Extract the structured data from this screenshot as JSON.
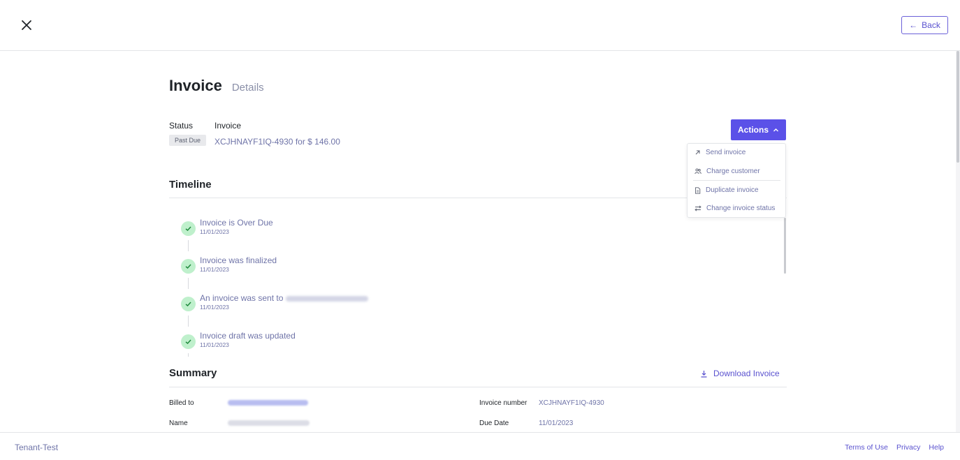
{
  "header": {
    "back_label": "Back",
    "back_arrow": "←"
  },
  "page": {
    "title": "Invoice",
    "subtitle": "Details"
  },
  "status": {
    "label": "Status",
    "badge": "Past Due",
    "invoice_label": "Invoice",
    "invoice_desc": "XCJHNAYF1IQ-4930 for $ 146.00"
  },
  "actions": {
    "label": "Actions",
    "menu": [
      {
        "label": "Send invoice",
        "icon": "arrow-up-right-icon"
      },
      {
        "label": "Charge customer",
        "icon": "users-icon"
      },
      {
        "label": "Duplicate invoice",
        "icon": "document-icon"
      },
      {
        "label": "Change invoice status",
        "icon": "swap-arrows-icon"
      }
    ]
  },
  "timeline": {
    "title": "Timeline",
    "items": [
      {
        "title": "Invoice is Over Due",
        "date": "11/01/2023"
      },
      {
        "title": "Invoice was finalized",
        "date": "11/01/2023"
      },
      {
        "title": "An invoice was sent to",
        "date": "11/01/2023"
      },
      {
        "title": "Invoice draft was updated",
        "date": "11/01/2023"
      }
    ]
  },
  "summary": {
    "title": "Summary",
    "download_label": "Download Invoice",
    "billed_to_label": "Billed to",
    "name_label": "Name",
    "invoice_number_label": "Invoice number",
    "invoice_number": "XCJHNAYF1IQ-4930",
    "due_date_label": "Due Date",
    "due_date": "11/01/2023"
  },
  "footer": {
    "tenant": "Tenant-Test",
    "links": [
      "Terms of Use",
      "Privacy",
      "Help"
    ]
  },
  "colors": {
    "accent": "#5b51e8",
    "link": "#5a52cf",
    "muted_text": "#6f74a8",
    "check_bg": "#bff0cc",
    "check_mark": "#1f8a3c"
  }
}
